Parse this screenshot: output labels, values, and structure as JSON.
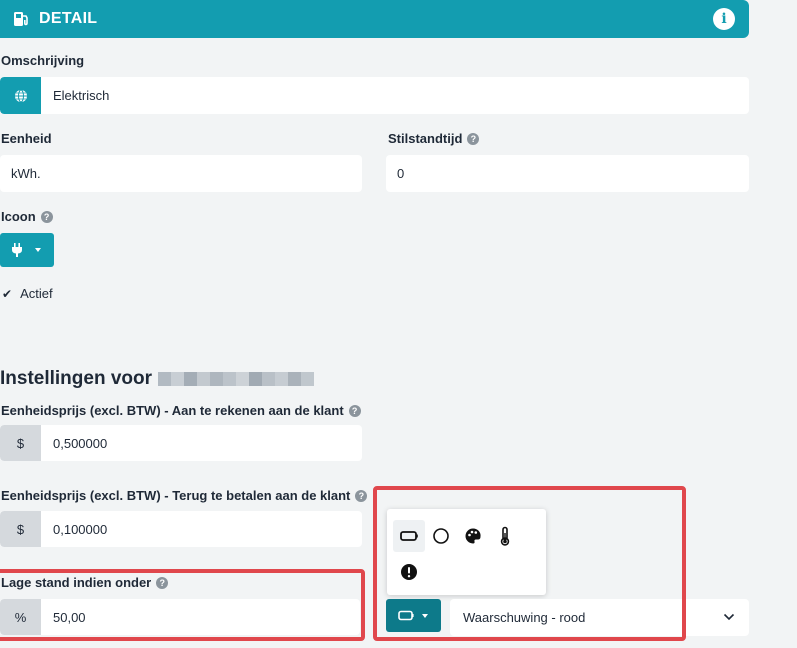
{
  "header": {
    "title": "DETAIL",
    "icon": "fuel-pump-icon",
    "info_icon": "info-icon",
    "info_glyph": "i",
    "color": "#139db0"
  },
  "omschrijving": {
    "label": "Omschrijving",
    "value": "Elektrisch",
    "icon": "globe-icon"
  },
  "eenheid": {
    "label": "Eenheid",
    "value": "kWh."
  },
  "stilstandtijd": {
    "label": "Stilstandtijd",
    "value": "0",
    "help": "?"
  },
  "icoon": {
    "label": "Icoon",
    "help": "?",
    "selected_icon": "plug-icon"
  },
  "actief": {
    "label": "Actief",
    "checked": true,
    "glyph": "✔"
  },
  "settings": {
    "heading": "Instellingen voor"
  },
  "prijs_rekenen": {
    "label": "Eenheidsprijs (excl. BTW) - Aan te rekenen aan de klant",
    "help": "?",
    "addon": "$",
    "value": "0,500000"
  },
  "prijs_terug": {
    "label": "Eenheidsprijs (excl. BTW) - Terug te betalen aan de klant",
    "help": "?",
    "addon": "$",
    "value": "0,100000"
  },
  "lage_stand": {
    "label": "Lage stand indien onder",
    "help": "?",
    "addon": "%",
    "value": "50,00"
  },
  "indicator": {
    "selected_icon": "battery-icon",
    "options": [
      "battery-icon",
      "circle-icon",
      "palette-icon",
      "thermometer-icon",
      "exclamation-icon"
    ],
    "select_value": "Waarschuwing - rood"
  },
  "colors": {
    "accent": "#139db0",
    "highlight": "#e0474c",
    "background": "#f2f4f5"
  }
}
